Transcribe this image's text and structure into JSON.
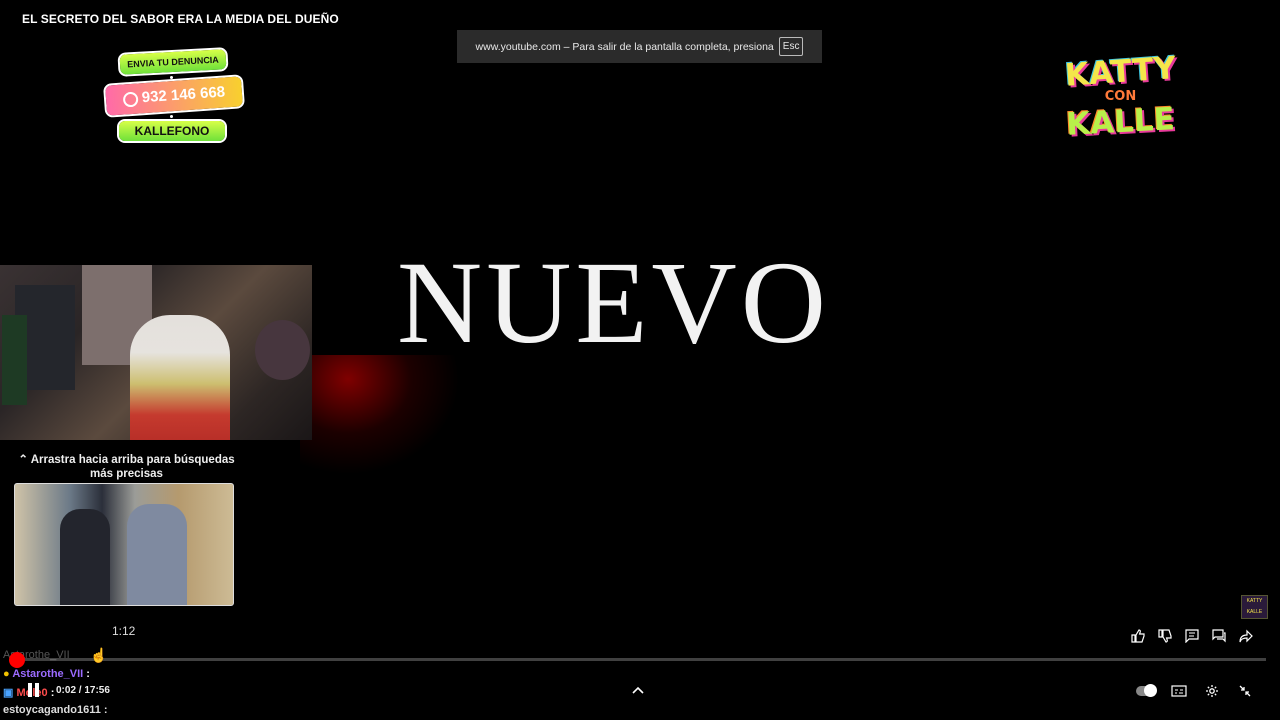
{
  "player": {
    "title": "EL SECRETO DEL SABOR ERA LA MEDIA DEL DUEÑO",
    "fullscreen_notice": "www.youtube.com – Para salir de la pantalla completa, presiona",
    "fullscreen_key": "Esc",
    "current_time": "0:02",
    "duration": "17:56",
    "time_display": "0:02 / 17:56",
    "progress_fraction": 0.002,
    "accent_color": "#ff0000"
  },
  "overlay": {
    "promo_line1": "ENVIA TU DENUNCIA",
    "promo_phone": "932 146 668",
    "promo_line3": "KALLEFONO",
    "logo_line1": "KATTY",
    "logo_line2": "CON",
    "logo_line3": "KALLE",
    "headline": "NUEVO"
  },
  "seek": {
    "hint": "Arrastra hacia arriba para búsquedas más precisas",
    "hint_icon": "double-chevron-up-icon",
    "preview_time": "1:12"
  },
  "chat": [
    {
      "user": "Astarothe_VII",
      "sep": ":"
    },
    {
      "user": "Mole0",
      "sep": ":"
    },
    {
      "user": "estoycagando1611",
      "sep": ":"
    }
  ],
  "chat_ghost": "Astarothe_VII",
  "icons": {
    "like": "thumbs-up-icon",
    "dislike": "thumbs-down-icon",
    "comments": "comment-icon",
    "live_chat": "chat-icon",
    "share": "share-icon",
    "autoplay": "autoplay-toggle",
    "captions": "captions-icon",
    "settings": "gear-icon",
    "exit_fullscreen": "exit-fullscreen-icon",
    "expand": "chevron-up-icon"
  }
}
